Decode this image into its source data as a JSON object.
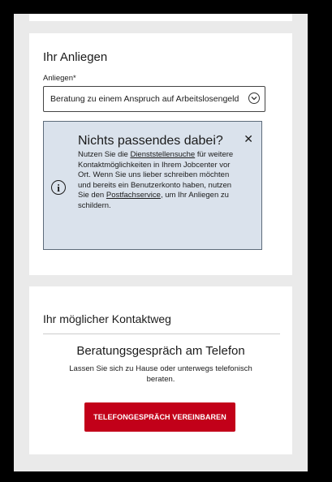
{
  "anliegen_section": {
    "title": "Ihr Anliegen",
    "field_label": "Anliegen*",
    "selected_value": "Beratung zu einem Anspruch auf Arbeitslosengeld",
    "info_box": {
      "title": "Nichts passendes dabei?",
      "text_before_link1": "Nutzen Sie die ",
      "link1_label": "Dienststellensuche",
      "text_after_link1": " für weitere Kontaktmöglichkeiten in Ihrem Jobcenter vor Ort. Wenn Sie uns lieber schreiben möchten und bereits ein Benutzerkonto haben, nutzen Sie den ",
      "link2_label": "Postfachservice",
      "text_after_link2": ", um Ihr Anliegen zu schildern.",
      "close_symbol": "✕",
      "info_symbol": "i"
    }
  },
  "kontakt_section": {
    "title": "Ihr möglicher Kontaktweg",
    "method_title": "Beratungsgespräch am Telefon",
    "method_description": "Lassen Sie sich zu Hause oder unterwegs telefonisch beraten.",
    "button_label": "TELEFONGESPRÄCH VEREINBAREN"
  },
  "colors": {
    "page_background": "#eaeaea",
    "info_background": "#dae2ec",
    "primary_button": "#c20019"
  }
}
